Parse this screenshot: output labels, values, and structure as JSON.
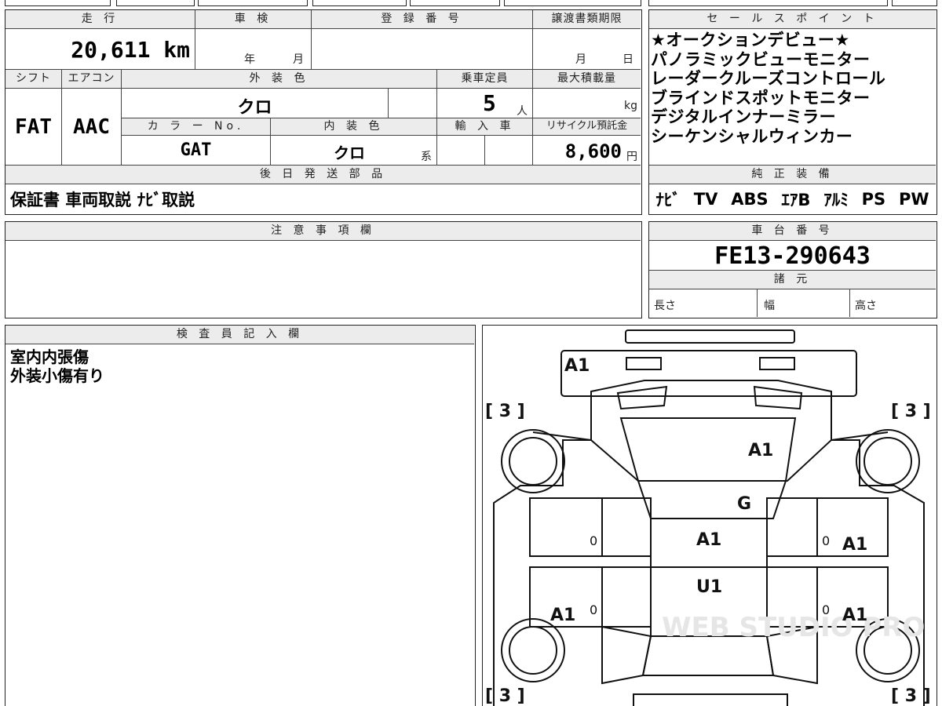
{
  "vehicle": {
    "mileage_header": "走 行",
    "mileage": "20,611 km",
    "inspection_header": "車 検",
    "inspection_year": "年",
    "inspection_month": "月",
    "registration_header": "登 録 番 号",
    "transfer_header": "譲渡書類期限",
    "transfer_month": "月",
    "transfer_day": "日",
    "shift_header": "シフト",
    "shift": "FAT",
    "ac_header": "エアコン",
    "ac": "AAC",
    "exterior_header": "外 装 色",
    "exterior_color": "クロ",
    "capacity_header": "乗車定員",
    "capacity": "5",
    "capacity_unit": "人",
    "max_load_header": "最大積載量",
    "max_load_unit": "kg",
    "color_no_header": "カ ラ ー No.",
    "color_no": "GAT",
    "interior_header": "内 装 色",
    "interior_color": "クロ",
    "interior_suffix": "系",
    "import_header": "輸 入 車",
    "recycle_header": "リサイクル預託金",
    "recycle_fee": "8,600",
    "recycle_unit": "円"
  },
  "parts": {
    "header": "後 日 発 送 部 品",
    "value": "保証書 車両取説 ﾅﾋﾞ取説"
  },
  "sales_points": {
    "header": "セ ー ル ス ポ イ ン ト",
    "items": [
      "★オークションデビュー★",
      "パノラミックビューモニター",
      "レーダークルーズコントロール",
      "ブラインドスポットモニター",
      "デジタルインナーミラー",
      "シーケンシャルウィンカー"
    ]
  },
  "equipment": {
    "header": "純 正 装 備",
    "items": [
      "ﾅﾋﾞ",
      "TV",
      "ABS",
      "ｴｱB",
      "ｱﾙﾐ",
      "PS",
      "PW"
    ]
  },
  "notes": {
    "header": "注 意 事 項 欄",
    "value": ""
  },
  "chassis": {
    "header": "車 台 番 号",
    "number": "FE13-290643",
    "specs_header": "諸 元",
    "length_label": "長さ",
    "width_label": "幅",
    "height_label": "高さ"
  },
  "inspector": {
    "header": "検 査 員 記 入 欄",
    "lines": [
      "室内内張傷",
      "外装小傷有り"
    ]
  },
  "diagram": {
    "marks": {
      "front_bumper": "A1",
      "bonnet": "A1",
      "windshield": "G",
      "roof": "A1",
      "rear_roof": "U1",
      "right_front_door": "A1",
      "right_rear_door": "A1",
      "left_rear_door": "A1"
    },
    "tires": [
      "[ 3 ]",
      "[ 3 ]",
      "[ 3 ]",
      "[ 3 ]"
    ],
    "zeros": [
      "0",
      "0",
      "0",
      "0"
    ],
    "watermark": "WEB STUDIO PRO"
  }
}
